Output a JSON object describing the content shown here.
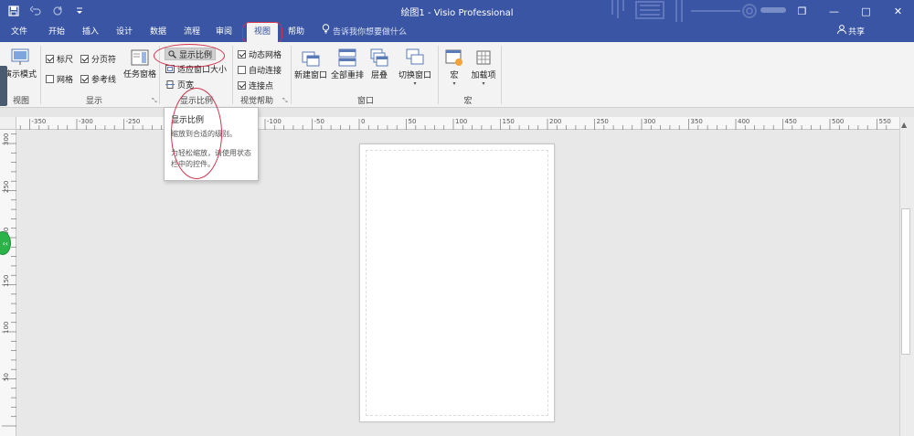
{
  "window": {
    "title": "绘图1  -  Visio Professional",
    "restore_glyph": "❐",
    "minimize_glyph": "—",
    "maximize_glyph": "□",
    "close_glyph": "✕"
  },
  "qat": {
    "save": "save-icon",
    "undo": "undo-icon",
    "redo": "redo-icon",
    "customize": "customize-icon"
  },
  "tabs": [
    {
      "label": "文件"
    },
    {
      "label": "开始"
    },
    {
      "label": "插入"
    },
    {
      "label": "设计"
    },
    {
      "label": "数据"
    },
    {
      "label": "流程"
    },
    {
      "label": "审阅"
    },
    {
      "label": "视图"
    },
    {
      "label": "帮助"
    }
  ],
  "tell_me": "告诉我你想要做什么",
  "share": "共享",
  "ribbon": {
    "view": {
      "presentation_mode": "演示模式",
      "group": "视图"
    },
    "show": {
      "ruler": "标尺",
      "page_breaks": "分页符",
      "grid": "网格",
      "guides": "参考线",
      "task_panes": "任务窗格",
      "group": "显示"
    },
    "zoom": {
      "zoom": "显示比例",
      "fit_window": "适应窗口大小",
      "page_width": "页宽",
      "group": "显示比例"
    },
    "visual_aids": {
      "dynamic_grid": "动态网格",
      "auto_connect": "自动连接",
      "connection_points": "连接点",
      "group": "视觉帮助"
    },
    "window": {
      "new_window": "新建窗口",
      "arrange_all": "全部重排",
      "cascade": "层叠",
      "switch_windows": "切换窗口",
      "group": "窗口"
    },
    "macros": {
      "macros": "宏",
      "add_ons": "加载项",
      "group": "宏"
    }
  },
  "tooltip": {
    "title": "显示比例",
    "description": "缩放到合适的级别。",
    "hint": "为轻松缩放，请使用状态栏中的控件。"
  },
  "ruler": {
    "h_labels": [
      "-350",
      "-300",
      "-250",
      "-200",
      "-150",
      "-100",
      "-50",
      "0",
      "50",
      "100",
      "150",
      "200",
      "250",
      "300",
      "350",
      "400",
      "450",
      "500",
      "550"
    ],
    "v_labels": [
      "300",
      "250",
      "200",
      "150",
      "100",
      "50"
    ]
  },
  "side_button": "‹‹",
  "colors": {
    "accent": "#3955a3",
    "annotation": "#d2334d"
  }
}
